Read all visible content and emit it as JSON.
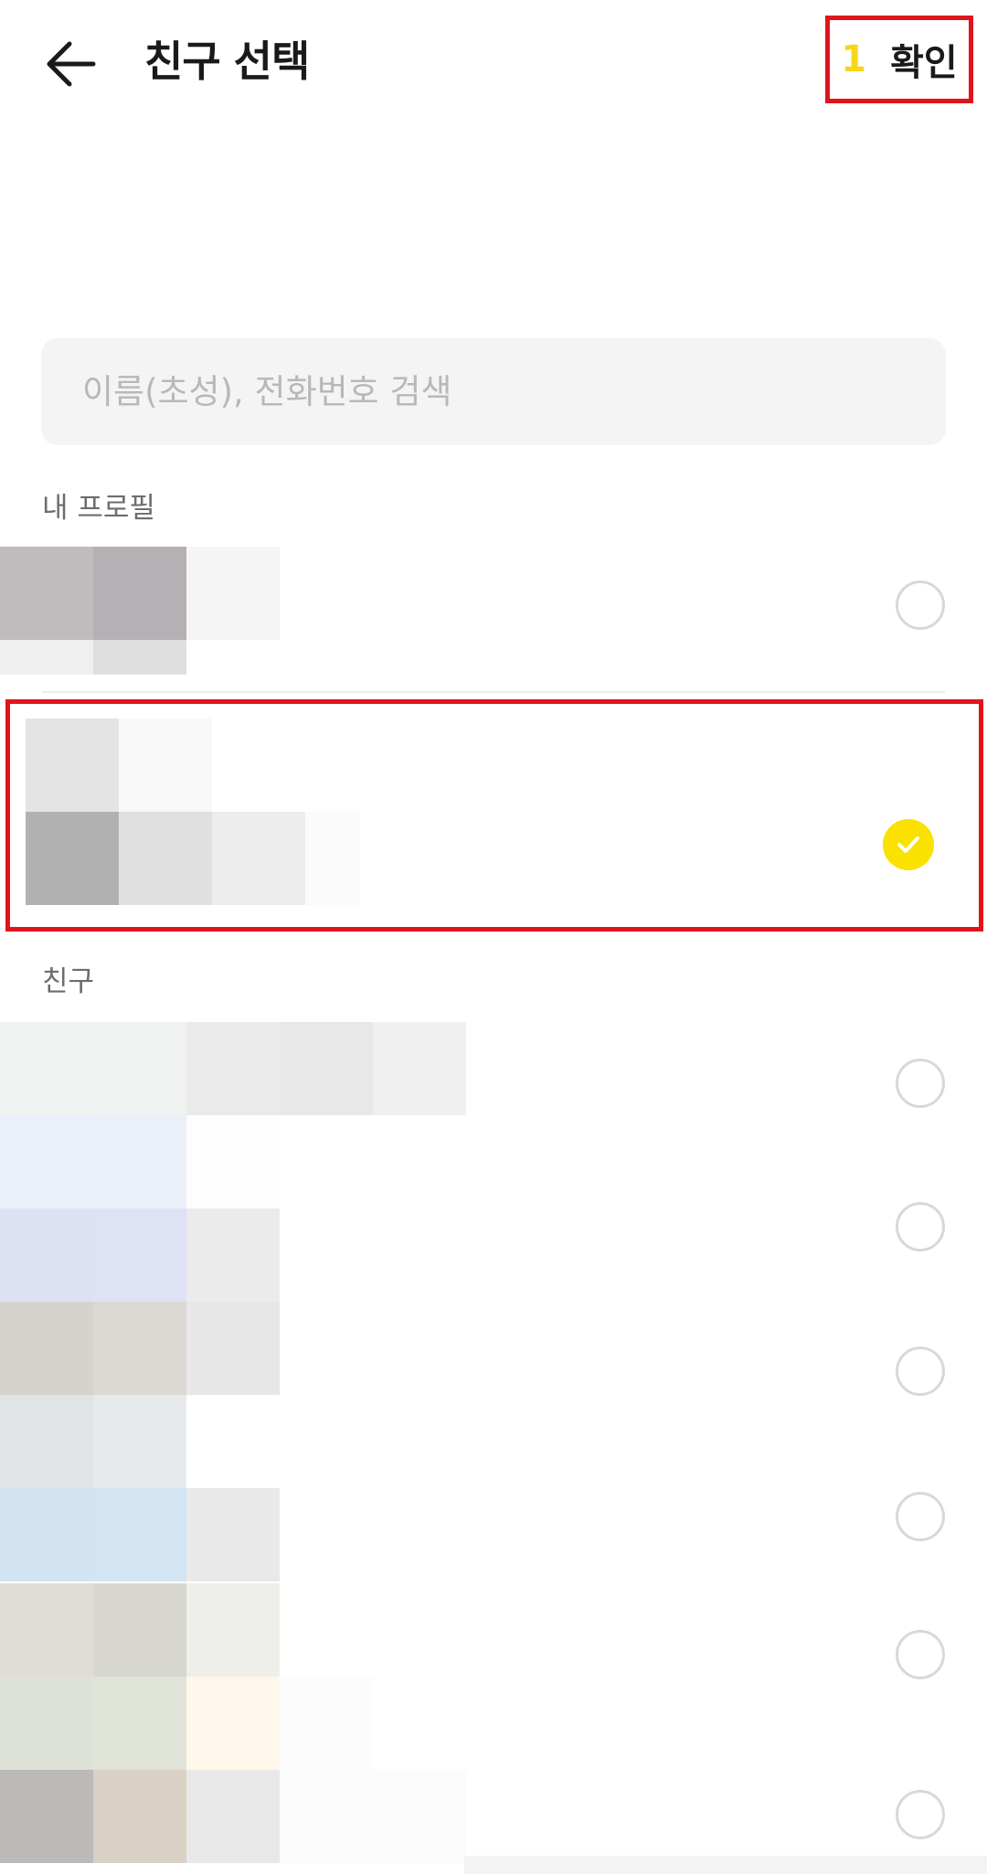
{
  "header": {
    "title": "친구 선택",
    "confirm_count": "1",
    "confirm_label": "확인"
  },
  "search": {
    "placeholder": "이름(초성), 전화번호 검색",
    "value": ""
  },
  "sections": {
    "my_profile": "내 프로필",
    "friends": "친구"
  },
  "colors": {
    "accent": "#fae100",
    "highlight_frame": "#e0141c"
  },
  "selection": {
    "my_profile_selected": false,
    "selected_friend_index": 0,
    "friends_selected": [
      false,
      false,
      false,
      false,
      false,
      false
    ]
  }
}
